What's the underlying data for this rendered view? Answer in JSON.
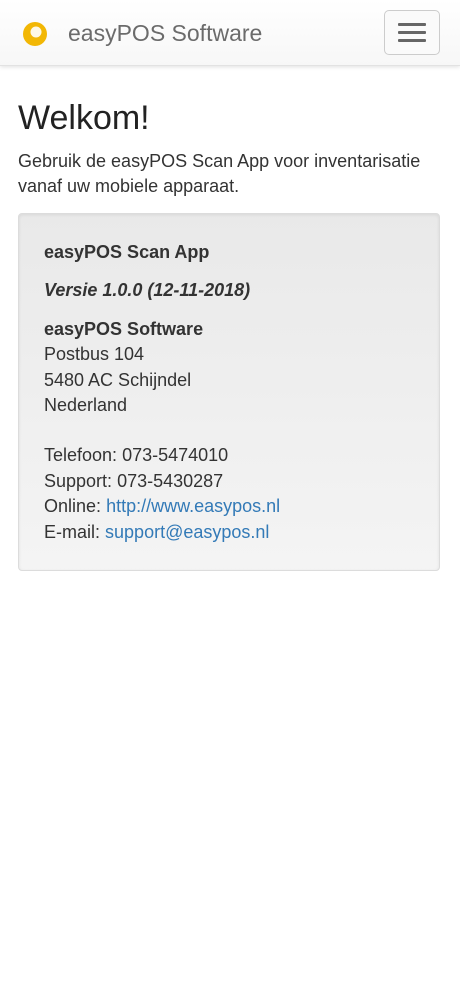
{
  "navbar": {
    "brand_name": "easyPOS Software",
    "logo_icon": "easypos-logo-icon",
    "menu_icon": "hamburger-menu-icon"
  },
  "main": {
    "title": "Welkom!",
    "intro": "Gebruik de easyPOS Scan App voor inventarisatie vanaf uw mobiele apparaat."
  },
  "card": {
    "app_name": "easyPOS Scan App",
    "version": "Versie 1.0.0 (12-11-2018)",
    "company": "easyPOS Software",
    "address_line1": "Postbus 104",
    "address_line2": "5480 AC Schijndel",
    "address_line3": "Nederland",
    "phone_label": "Telefoon:",
    "phone_value": "073-5474010",
    "support_label": "Support:",
    "support_value": "073-5430287",
    "online_label": "Online:",
    "online_link": "http://www.easypos.nl",
    "email_label": "E-mail:",
    "email_link": "support@easypos.nl"
  },
  "colors": {
    "link": "#337ab7",
    "logo_yellow": "#f2b705",
    "logo_green": "#8cbf26"
  }
}
